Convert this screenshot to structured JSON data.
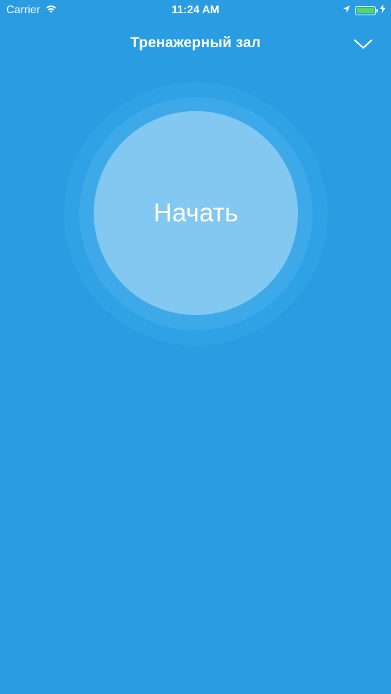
{
  "status_bar": {
    "carrier": "Carrier",
    "time": "11:24 AM",
    "icons": [
      "wifi-icon",
      "location-arrow-icon",
      "battery-icon",
      "charging-bolt-icon"
    ]
  },
  "header": {
    "title": "Тренажерный зал",
    "collapse_icon": "chevron-down-icon"
  },
  "main": {
    "start_label": "Начать"
  },
  "colors": {
    "background": "#299CE2",
    "ring_outer": "#2FA1E5",
    "ring_mid": "#3DA9E9",
    "start_circle": "#82C8F1",
    "battery": "#4CD964",
    "text": "#FFFFFF"
  }
}
